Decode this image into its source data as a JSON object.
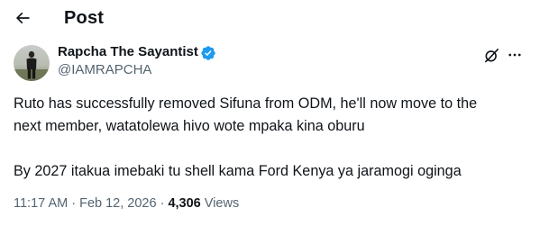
{
  "header": {
    "title": "Post"
  },
  "author": {
    "name": "Rapcha The Sayantist",
    "handle": "@IAMRAPCHA",
    "verified": true
  },
  "tweet": {
    "line1": "Ruto has successfully removed Sifuna from ODM, he'll now move to the",
    "line2": "next member, watatolewa hivo wote mpaka kina oburu",
    "line3": "By 2027 itakua imebaki tu shell kama Ford Kenya ya jaramogi oginga"
  },
  "meta": {
    "time": "11:17 AM",
    "separator1": " · ",
    "date": "Feb 12, 2026",
    "separator2": " · ",
    "views_count": "4,306",
    "views_label": " Views"
  },
  "colors": {
    "text": "#0f1419",
    "secondary": "#536471",
    "verified_badge": "#1d9bf0"
  },
  "icons": {
    "back": "back-arrow-icon",
    "verified": "verified-badge-icon",
    "grok": "grok-icon",
    "more": "more-icon"
  }
}
